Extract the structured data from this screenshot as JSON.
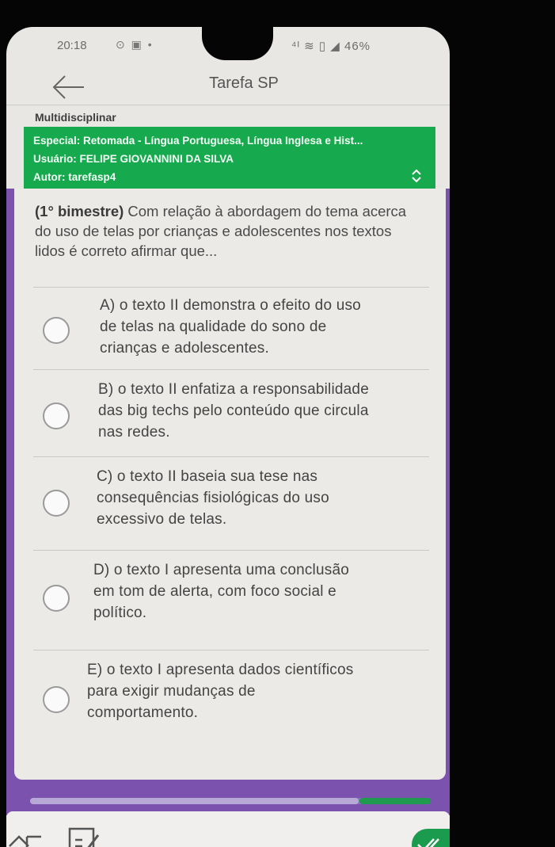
{
  "status": {
    "time": "20:18",
    "right": "46%"
  },
  "header": {
    "title": "Tarefa SP"
  },
  "category": "Multidisciplinar",
  "info": {
    "title": "Especial: Retomada - Língua Portuguesa, Língua Inglesa e Hist...",
    "user": "Usuário: FELIPE GIOVANNINI DA SILVA",
    "author": "Autor: tarefasp4"
  },
  "question": {
    "prefix": "(1° bimestre)",
    "text": " Com relação à abordagem do tema acerca do uso de telas por crianças e adolescentes nos textos lidos é correto afirmar que..."
  },
  "options": [
    {
      "line1": "A) o texto II demonstra o efeito do uso",
      "line2": "de telas na qualidade do sono de",
      "line3": "crianças e adolescentes."
    },
    {
      "line1": "B) o texto II enfatiza a responsabilidade",
      "line2": "das big techs pelo conteúdo que circula",
      "line3": "nas redes."
    },
    {
      "line1": "C) o texto II baseia sua tese nas",
      "line2": "consequências fisiológicas do uso",
      "line3": "excessivo de telas."
    },
    {
      "line1": "D) o texto I apresenta uma conclusão",
      "line2": "em tom de alerta, com foco social e",
      "line3": "político."
    },
    {
      "line1": "E) o texto I apresenta dados científicos",
      "line2": "para exigir mudanças de",
      "line3": "comportamento."
    }
  ],
  "progress": {
    "fraction": 0.82
  },
  "colors": {
    "green": "#16a94e",
    "purple": "#7b52ad"
  },
  "icons": {
    "back": "arrow-left-icon",
    "collapse": "chevron-up-down-icon",
    "nav_back": "return-arrow-icon",
    "notes": "edit-note-icon",
    "submit": "double-check-icon"
  }
}
